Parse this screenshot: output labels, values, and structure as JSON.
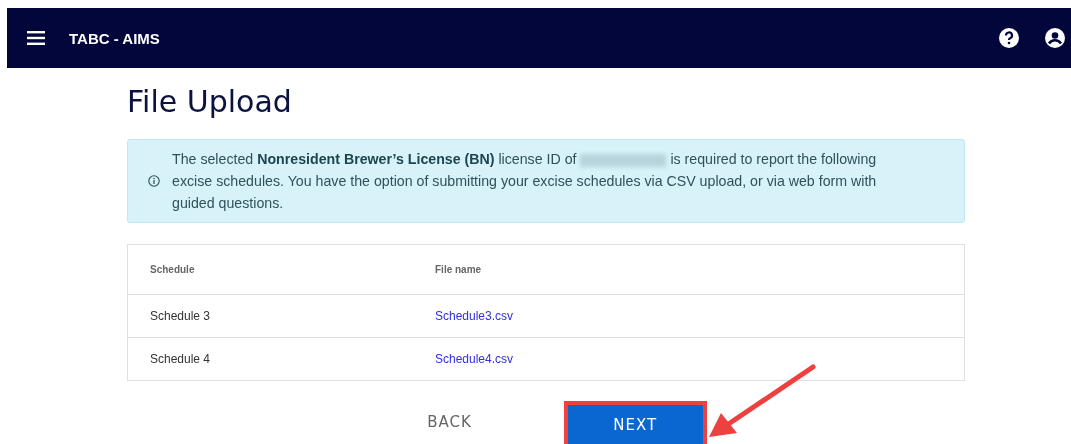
{
  "app_bar": {
    "title": "TABC - AIMS"
  },
  "page_title": "File Upload",
  "alert": {
    "before": "The selected **Nonresident Brewer’s License (BN)** license ID of",
    "redacted": true,
    "after": "is required to report the following excise schedules. You have the option of submitting your excise schedules via CSV upload, or via web form with guided questions."
  },
  "table": {
    "columns": [
      "Schedule",
      "File name"
    ],
    "rows": [
      {
        "schedule": "Schedule 3",
        "file": "Schedule3.csv"
      },
      {
        "schedule": "Schedule 4",
        "file": "Schedule4.csv"
      }
    ]
  },
  "buttons": [
    {
      "label": "BACK",
      "kind": "text",
      "highlighted": false
    },
    {
      "label": "NEXT",
      "kind": "primary",
      "highlighted": true
    }
  ]
}
